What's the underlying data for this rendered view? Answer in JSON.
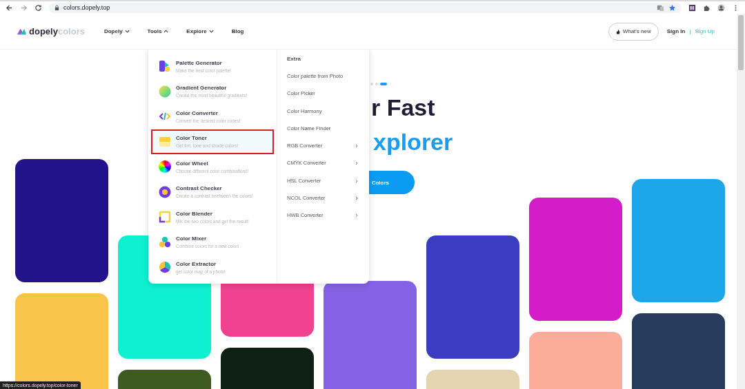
{
  "browser": {
    "url": "colors.dopely.top"
  },
  "nav": {
    "logo": {
      "bold": "dopely",
      "light": "colors"
    },
    "items": [
      {
        "label": "Dopely",
        "kind": "dropdown",
        "expanded": false
      },
      {
        "label": "Tools",
        "kind": "dropdown",
        "expanded": true
      },
      {
        "label": "Explore",
        "kind": "dropdown",
        "expanded": false
      },
      {
        "label": "Blog",
        "kind": "link"
      }
    ],
    "whats_new": "What's new",
    "sign_in": "Sign In",
    "separator": "|",
    "sign_up": "Sign Up"
  },
  "tools_menu": {
    "tools": [
      {
        "title": "Palette Generator",
        "subtitle": "Make the best color palette!",
        "highlighted": false
      },
      {
        "title": "Gradient Generator",
        "subtitle": "Create the most beautiful gradients!",
        "highlighted": false
      },
      {
        "title": "Color Converter",
        "subtitle": "Convert the desired color codes!",
        "highlighted": false
      },
      {
        "title": "Color Toner",
        "subtitle": "Get tint, tone and shade colors!",
        "highlighted": true
      },
      {
        "title": "Color Wheel",
        "subtitle": "Choose different color combinations!",
        "highlighted": false
      },
      {
        "title": "Contrast Checker",
        "subtitle": "Create a contrast beetween the colors!",
        "highlighted": false
      },
      {
        "title": "Color Blender",
        "subtitle": "Mix the two colors and get the result!",
        "highlighted": false
      },
      {
        "title": "Color Mixer",
        "subtitle": "Combine colors for a new color!",
        "highlighted": false
      },
      {
        "title": "Color Extractor",
        "subtitle": "get color map of a photo!",
        "highlighted": false
      }
    ],
    "extra": {
      "heading": "Extra",
      "items": [
        {
          "label": "Color palette from Photo",
          "has_submenu": false
        },
        {
          "label": "Color Picker",
          "has_submenu": false
        },
        {
          "label": "Color Harmony",
          "has_submenu": false
        },
        {
          "label": "Color Name Finder",
          "has_submenu": false
        },
        {
          "label": "RGB Converter",
          "has_submenu": true
        },
        {
          "label": "CMYK Converter",
          "has_submenu": true
        },
        {
          "label": "HSL Converter",
          "has_submenu": true
        },
        {
          "label": "NCOL Converter",
          "has_submenu": true
        },
        {
          "label": "HWB Converter",
          "has_submenu": true
        }
      ]
    }
  },
  "hero": {
    "slides": [
      {
        "selected": false
      },
      {
        "selected": false
      },
      {
        "selected": true
      }
    ],
    "line_1": "r Fast",
    "line_2": "xplorer",
    "button": "Colors"
  },
  "tile_columns": [
    [
      {
        "color": "#23128a"
      },
      {
        "color": "#f9c44a"
      }
    ],
    [
      {
        "color": "#0ef1d1"
      },
      {
        "color": "#3e5a20"
      }
    ],
    [
      {
        "color": "#f0428f"
      },
      {
        "color": "#0f2014"
      }
    ],
    [
      {
        "color": "#8462e6"
      }
    ],
    [
      {
        "color": "#3b3dc0"
      },
      {
        "color": "#e4d5b0"
      }
    ],
    [
      {
        "color": "#d41ccb"
      },
      {
        "color": "#f9ad9a"
      }
    ],
    [
      {
        "color": "#1da6ea"
      },
      {
        "color": "#273b5c"
      }
    ]
  ],
  "status_url": "https://colors.dopely.top/color-toner"
}
